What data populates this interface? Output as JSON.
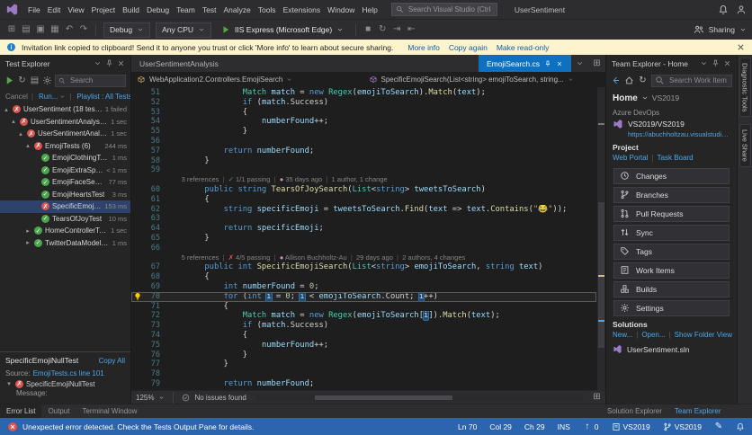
{
  "colors": {
    "accent": "#0e70c0",
    "statusbar": "#2a65ad",
    "infobar": "#fdf3cd",
    "link": "#4da6e8",
    "pass": "#4ca64c",
    "fail": "#d9534f",
    "kw": "#569cd6",
    "ty": "#4ec9b0",
    "me": "#dcdcaa",
    "va": "#9cdcfe",
    "st": "#d69d85",
    "nu": "#b5cea8",
    "lnum": "#4a7a8c"
  },
  "titlebar": {
    "menus": [
      "File",
      "Edit",
      "View",
      "Project",
      "Build",
      "Debug",
      "Team",
      "Test",
      "Analyze",
      "Tools",
      "Extensions",
      "Window",
      "Help"
    ],
    "search_placeholder": "Search Visual Studio (Ctrl+Q)",
    "window_title": "UserSentiment"
  },
  "toolbar": {
    "file_icons": [
      "new-project-icon",
      "open-file-icon",
      "save-icon",
      "save-all-icon",
      "undo-icon",
      "redo-icon"
    ],
    "config": "Debug",
    "platform": "Any CPU",
    "run_label": "IIS Express (Microsoft Edge)",
    "debug_icons": [
      "stop-icon",
      "restart-icon",
      "step-into-icon",
      "step-over-icon"
    ],
    "sharing_label": "Sharing"
  },
  "infobar": {
    "message": "Invitation link copied to clipboard! Send it to anyone you trust or click 'More info' to learn about secure sharing.",
    "links": [
      "More info",
      "Copy again",
      "Make read-only"
    ]
  },
  "test_explorer": {
    "title": "Test Explorer",
    "search_placeholder": "Search",
    "commands": [
      {
        "label": "Cancel",
        "muted": true,
        "chev": false
      },
      {
        "label": "Run...",
        "muted": false,
        "chev": true
      },
      {
        "label": "Playlist : All Tests",
        "muted": false,
        "chev": true
      }
    ],
    "tree": [
      {
        "depth": 0,
        "chev": "▴",
        "state": "fail",
        "label": "UserSentiment (18 tests)",
        "time": "1 failed"
      },
      {
        "depth": 1,
        "chev": "▴",
        "state": "fail",
        "label": "UserSentimentAnalysis... (18)",
        "time": "1 sec"
      },
      {
        "depth": 2,
        "chev": "▴",
        "state": "fail",
        "label": "UserSentimentAnal... (18)",
        "time": "1 sec"
      },
      {
        "depth": 3,
        "chev": "▴",
        "state": "fail",
        "label": "EmojiTests (6)",
        "time": "244 ms"
      },
      {
        "depth": 4,
        "chev": "",
        "state": "pass",
        "label": "EmojiClothingTest",
        "time": "1 ms"
      },
      {
        "depth": 4,
        "chev": "",
        "state": "pass",
        "label": "EmojiExtraSpecial...",
        "time": "< 1 ms"
      },
      {
        "depth": 4,
        "chev": "",
        "state": "pass",
        "label": "EmojiFaceSearchTest",
        "time": "77 ms"
      },
      {
        "depth": 4,
        "chev": "",
        "state": "pass",
        "label": "EmojiHeartsTest",
        "time": "3 ms"
      },
      {
        "depth": 4,
        "chev": "",
        "state": "fail",
        "label": "SpecificEmojiNullT...",
        "time": "153 ms",
        "selected": true
      },
      {
        "depth": 4,
        "chev": "",
        "state": "pass",
        "label": "TearsOfJoyTest",
        "time": "10 ms"
      },
      {
        "depth": 3,
        "chev": "▸",
        "state": "pass",
        "label": "HomeControllerTe... (6)",
        "time": "1 sec"
      },
      {
        "depth": 3,
        "chev": "▸",
        "state": "pass",
        "label": "TwitterDataModel... (6)",
        "time": "1 ms"
      }
    ],
    "details": {
      "name": "SpecificEmojiNullTest",
      "copy_all": "Copy All",
      "source_label": "Source:",
      "source": "EmojiTests.cs line 101",
      "result": "SpecificEmojiNullTest",
      "message_label": "Message:"
    }
  },
  "editor": {
    "tab_left": "UserSentimentAnalysis",
    "tab_preview": "EmojiSearch.cs",
    "breadcrumb_scope": "WebApplication2.Controllers.EmojiSearch",
    "breadcrumb_member": "SpecificEmojiSearch(List<string> emojiToSearch, string...",
    "zoom": "125%",
    "health": "No issues found",
    "lines": [
      {
        "num": "51",
        "tokens": [
          [
            "                ",
            "pl"
          ],
          [
            "Match",
            "ty"
          ],
          [
            " ",
            "pl"
          ],
          [
            "match",
            "va"
          ],
          [
            " = ",
            "pl"
          ],
          [
            "new",
            "kw"
          ],
          [
            " ",
            "pl"
          ],
          [
            "Regex",
            "ty"
          ],
          [
            "(",
            "pl"
          ],
          [
            "emojiToSearch",
            "va"
          ],
          [
            ").",
            "pl"
          ],
          [
            "Match",
            "me"
          ],
          [
            "(",
            "pl"
          ],
          [
            "text",
            "va"
          ],
          [
            ");",
            "pl"
          ]
        ]
      },
      {
        "num": "52",
        "tokens": [
          [
            "                ",
            "pl"
          ],
          [
            "if",
            "kw"
          ],
          [
            " (",
            "pl"
          ],
          [
            "match",
            "va"
          ],
          [
            ".Success)",
            "pl"
          ]
        ]
      },
      {
        "num": "53",
        "tokens": [
          [
            "                {",
            "pl"
          ]
        ]
      },
      {
        "num": "54",
        "tokens": [
          [
            "                    ",
            "pl"
          ],
          [
            "numberFound",
            "va"
          ],
          [
            "++;",
            "pl"
          ]
        ]
      },
      {
        "num": "55",
        "tokens": [
          [
            "                }",
            "pl"
          ]
        ]
      },
      {
        "num": "56",
        "tokens": []
      },
      {
        "num": "57",
        "tokens": [
          [
            "            ",
            "pl"
          ],
          [
            "return",
            "kw"
          ],
          [
            " ",
            "pl"
          ],
          [
            "numberFound",
            "va"
          ],
          [
            ";",
            "pl"
          ]
        ]
      },
      {
        "num": "58",
        "tokens": [
          [
            "        }",
            "pl"
          ]
        ]
      },
      {
        "num": "59",
        "tokens": []
      },
      {
        "cls": "codelens",
        "tokens": [
          [
            "        ",
            "pl"
          ],
          [
            "3 references",
            "cll"
          ],
          [
            "  |  ",
            "cse"
          ],
          [
            "✓ ",
            "clp"
          ],
          [
            "1/1 passing",
            "cll"
          ],
          [
            "  |  ",
            "cse"
          ],
          [
            "● ",
            "av"
          ],
          [
            "35 days ago",
            "cll"
          ],
          [
            "  |  ",
            "cse"
          ],
          [
            "1 author, 1 change",
            "cll"
          ]
        ]
      },
      {
        "num": "60",
        "tokens": [
          [
            "        ",
            "pl"
          ],
          [
            "public",
            "kw"
          ],
          [
            " ",
            "pl"
          ],
          [
            "string",
            "kw"
          ],
          [
            " ",
            "pl"
          ],
          [
            "TearsOfJoySearch",
            "me"
          ],
          [
            "(",
            "pl"
          ],
          [
            "List",
            "ty"
          ],
          [
            "<",
            "pl"
          ],
          [
            "string",
            "kw"
          ],
          [
            "> ",
            "pl"
          ],
          [
            "tweetsToSearch",
            "va"
          ],
          [
            ")",
            "pl"
          ]
        ]
      },
      {
        "num": "61",
        "tokens": [
          [
            "        {",
            "pl"
          ]
        ]
      },
      {
        "num": "62",
        "tokens": [
          [
            "            ",
            "pl"
          ],
          [
            "string",
            "kw"
          ],
          [
            " ",
            "pl"
          ],
          [
            "specificEmoji",
            "va"
          ],
          [
            " = ",
            "pl"
          ],
          [
            "tweetsToSearch",
            "va"
          ],
          [
            ".",
            "pl"
          ],
          [
            "Find",
            "me"
          ],
          [
            "(",
            "pl"
          ],
          [
            "text",
            "va"
          ],
          [
            " => ",
            "pl"
          ],
          [
            "text",
            "va"
          ],
          [
            ".",
            "pl"
          ],
          [
            "Contains",
            "me"
          ],
          [
            "(",
            "pl"
          ],
          [
            "\"😂\"",
            "st"
          ],
          [
            "));",
            "pl"
          ]
        ]
      },
      {
        "num": "63",
        "tokens": []
      },
      {
        "num": "64",
        "tokens": [
          [
            "            ",
            "pl"
          ],
          [
            "return",
            "kw"
          ],
          [
            " ",
            "pl"
          ],
          [
            "specificEmoji",
            "va"
          ],
          [
            ";",
            "pl"
          ]
        ]
      },
      {
        "num": "65",
        "tokens": [
          [
            "        }",
            "pl"
          ]
        ]
      },
      {
        "num": "66",
        "tokens": []
      },
      {
        "cls": "codelens",
        "tokens": [
          [
            "        ",
            "pl"
          ],
          [
            "5 references",
            "cll"
          ],
          [
            "  |  ",
            "cse"
          ],
          [
            "✗ ",
            "clf"
          ],
          [
            "4/5 passing",
            "cll"
          ],
          [
            "  |  ",
            "cse"
          ],
          [
            "● ",
            "av"
          ],
          [
            "Allison Buchholtz-Au",
            "cll"
          ],
          [
            "  |  ",
            "cse"
          ],
          [
            "29 days ago",
            "cll"
          ],
          [
            "  |  ",
            "cse"
          ],
          [
            "2 authors, 4 changes",
            "cll"
          ]
        ]
      },
      {
        "num": "67",
        "tokens": [
          [
            "        ",
            "pl"
          ],
          [
            "public",
            "kw"
          ],
          [
            " ",
            "pl"
          ],
          [
            "int",
            "kw"
          ],
          [
            " ",
            "pl"
          ],
          [
            "SpecificEmojiSearch",
            "me"
          ],
          [
            "(",
            "pl"
          ],
          [
            "List",
            "ty"
          ],
          [
            "<",
            "pl"
          ],
          [
            "string",
            "kw"
          ],
          [
            "> ",
            "pl"
          ],
          [
            "emojiToSearch",
            "va"
          ],
          [
            ", ",
            "pl"
          ],
          [
            "string",
            "kw"
          ],
          [
            " ",
            "pl"
          ],
          [
            "text",
            "va"
          ],
          [
            ")",
            "pl"
          ]
        ]
      },
      {
        "num": "68",
        "tokens": [
          [
            "        {",
            "pl"
          ]
        ]
      },
      {
        "num": "69",
        "tokens": [
          [
            "            ",
            "pl"
          ],
          [
            "int",
            "kw"
          ],
          [
            " ",
            "pl"
          ],
          [
            "numberFound",
            "va"
          ],
          [
            " = ",
            "pl"
          ],
          [
            "0",
            "nu"
          ],
          [
            ";",
            "pl"
          ]
        ]
      },
      {
        "num": "70",
        "current": true,
        "bulb": true,
        "tokens": [
          [
            "            ",
            "pl"
          ],
          [
            "for",
            "kw"
          ],
          [
            " (",
            "pl"
          ],
          [
            "int",
            "kw"
          ],
          [
            " ",
            "pl"
          ],
          [
            "i",
            "rf"
          ],
          [
            " = ",
            "pl"
          ],
          [
            "0",
            "nu"
          ],
          [
            "; ",
            "pl"
          ],
          [
            "i",
            "rf"
          ],
          [
            " < ",
            "pl"
          ],
          [
            "emojiToSearch",
            "va"
          ],
          [
            ".Count; ",
            "pl"
          ],
          [
            "i",
            "rf"
          ],
          [
            "++)",
            "pl"
          ]
        ]
      },
      {
        "num": "71",
        "tokens": [
          [
            "            {",
            "pl"
          ]
        ]
      },
      {
        "num": "72",
        "tokens": [
          [
            "                ",
            "pl"
          ],
          [
            "Match",
            "ty"
          ],
          [
            " ",
            "pl"
          ],
          [
            "match",
            "va"
          ],
          [
            " = ",
            "pl"
          ],
          [
            "new",
            "kw"
          ],
          [
            " ",
            "pl"
          ],
          [
            "Regex",
            "ty"
          ],
          [
            "(",
            "pl"
          ],
          [
            "emojiToSearch",
            "va"
          ],
          [
            "[",
            "pl"
          ],
          [
            "i",
            "rf"
          ],
          [
            "]).",
            "pl"
          ],
          [
            "Match",
            "me"
          ],
          [
            "(",
            "pl"
          ],
          [
            "text",
            "va"
          ],
          [
            ");",
            "pl"
          ]
        ]
      },
      {
        "num": "73",
        "tokens": [
          [
            "                ",
            "pl"
          ],
          [
            "if",
            "kw"
          ],
          [
            " (",
            "pl"
          ],
          [
            "match",
            "va"
          ],
          [
            ".Success)",
            "pl"
          ]
        ]
      },
      {
        "num": "74",
        "tokens": [
          [
            "                {",
            "pl"
          ]
        ]
      },
      {
        "num": "75",
        "tokens": [
          [
            "                    ",
            "pl"
          ],
          [
            "numberFound",
            "va"
          ],
          [
            "++;",
            "pl"
          ]
        ]
      },
      {
        "num": "76",
        "tokens": [
          [
            "                }",
            "pl"
          ]
        ]
      },
      {
        "num": "77",
        "tokens": [
          [
            "            }",
            "pl"
          ]
        ]
      },
      {
        "num": "78",
        "tokens": []
      },
      {
        "num": "79",
        "tokens": [
          [
            "            ",
            "pl"
          ],
          [
            "return",
            "kw"
          ],
          [
            " ",
            "pl"
          ],
          [
            "numberFound",
            "va"
          ],
          [
            ";",
            "pl"
          ]
        ]
      }
    ]
  },
  "team_explorer": {
    "title": "Team Explorer - Home",
    "search_placeholder": "Search Work Items (Ctrl...",
    "page": "Home",
    "context": "VS2019",
    "section_azure": "Azure DevOps",
    "account": "VS2019/VS2019",
    "account_url": "https://abuchholtzau.visualstudio...",
    "section_project": "Project",
    "project_links": [
      "Web Portal",
      "Task Board"
    ],
    "buttons": [
      {
        "icon": "clock-icon",
        "label": "Changes"
      },
      {
        "icon": "branch-icon",
        "label": "Branches"
      },
      {
        "icon": "pull-request-icon",
        "label": "Pull Requests"
      },
      {
        "icon": "sync-icon",
        "label": "Sync"
      },
      {
        "icon": "tag-icon",
        "label": "Tags"
      },
      {
        "icon": "work-items-icon",
        "label": "Work Items"
      },
      {
        "icon": "builds-icon",
        "label": "Builds"
      },
      {
        "icon": "gear-icon",
        "label": "Settings"
      }
    ],
    "section_solutions": "Solutions",
    "solutions_links": [
      "New...",
      "Open...",
      "Show Folder View"
    ],
    "solution_item": "UserSentiment.sln"
  },
  "panel_tabs": {
    "left": [
      "Error List",
      "Output",
      "Terminal Window"
    ],
    "right": [
      {
        "label": "Solution Explorer",
        "active": false
      },
      {
        "label": "Team Explorer",
        "active": true
      }
    ]
  },
  "statusbar": {
    "message": "Unexpected error detected. Check the Tests Output Pane for details.",
    "ln": "Ln 70",
    "col": "Col 29",
    "ch": "Ch 29",
    "mode": "INS",
    "ahead": "0",
    "repo": "VS2019",
    "branch": "VS2019"
  },
  "side_strip": {
    "tabs": [
      "Diagnostic Tools",
      "Live Share"
    ]
  }
}
